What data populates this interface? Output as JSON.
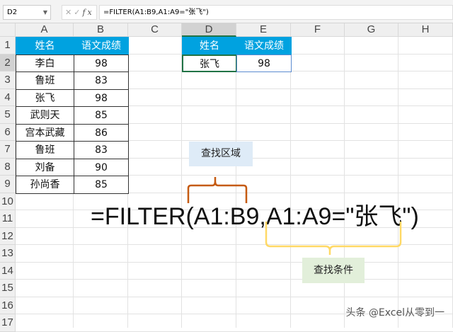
{
  "formula_bar": {
    "name_box": "D2",
    "fx": "fx",
    "formula": "=FILTER(A1:B9,A1:A9=\"张飞\")"
  },
  "columns": [
    "A",
    "B",
    "C",
    "D",
    "E",
    "F",
    "G",
    "H"
  ],
  "rows": [
    "1",
    "2",
    "3",
    "4",
    "5",
    "6",
    "7",
    "8",
    "9",
    "10",
    "11",
    "12",
    "13",
    "14",
    "15",
    "16",
    "17"
  ],
  "source_table": {
    "headers": [
      "姓名",
      "语文成绩"
    ],
    "rows": [
      [
        "李白",
        "98"
      ],
      [
        "鲁班",
        "83"
      ],
      [
        "张飞",
        "98"
      ],
      [
        "武则天",
        "85"
      ],
      [
        "宫本武藏",
        "86"
      ],
      [
        "鲁班",
        "83"
      ],
      [
        "刘备",
        "90"
      ],
      [
        "孙尚香",
        "85"
      ]
    ]
  },
  "result_table": {
    "headers": [
      "姓名",
      "语文成绩"
    ],
    "rows": [
      [
        "张飞",
        "98"
      ]
    ]
  },
  "annotation": {
    "formula": "=FILTER(A1:B9,A1:A9=\"张飞\")",
    "range_label": "查找区域",
    "criteria_label": "查找条件"
  },
  "watermark": "头条 @Excel从零到一",
  "colors": {
    "header": "#00a2e0",
    "range_brace": "#c55a11",
    "criteria_brace": "#ffd966",
    "range_box": "#deebf7",
    "criteria_box": "#e2efda"
  }
}
